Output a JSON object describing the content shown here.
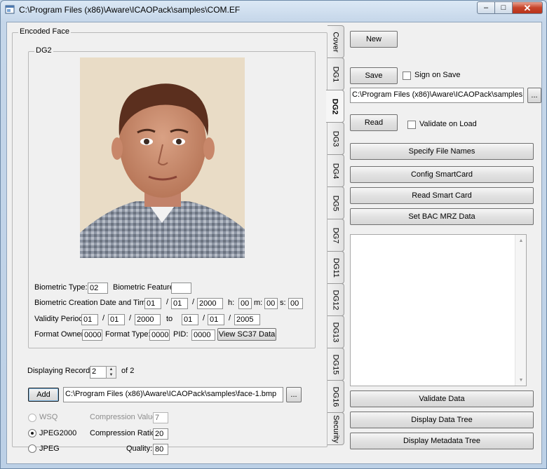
{
  "window": {
    "title": "C:\\Program Files (x86)\\Aware\\ICAOPack\\samples\\COM.EF",
    "minimize_glyph": "–",
    "maximize_glyph": "□",
    "close_glyph": "✕"
  },
  "encoded_face": {
    "legend": "Encoded Face",
    "dg2_legend": "DG2",
    "biometric_type_label": "Biometric Type:",
    "biometric_type": "02",
    "biometric_feature_label": "Biometric Feature:",
    "biometric_feature": "",
    "creation_label": "Biometric Creation Date and Time:",
    "creation_day": "01",
    "creation_month": "01",
    "creation_year": "2000",
    "h_label": "h:",
    "hour": "00",
    "m_label": "m:",
    "minute": "00",
    "s_label": "s:",
    "second": "00",
    "slash": "/",
    "validity_label": "Validity Period:",
    "valid_from_day": "01",
    "valid_from_month": "01",
    "valid_from_year": "2000",
    "to_label": "to",
    "valid_to_day": "01",
    "valid_to_month": "01",
    "valid_to_year": "2005",
    "format_owner_label": "Format Owner:",
    "format_owner": "0000",
    "format_type_label": "Format Type:",
    "format_type": "0000",
    "pid_label": "PID:",
    "pid": "0000",
    "view_sc37_label": "View SC37 Data",
    "displaying_record_label": "Displaying Record:",
    "record": "2",
    "of_label": "of 2",
    "add_label": "Add",
    "image_path": "C:\\Program Files (x86)\\Aware\\ICAOPack\\samples\\face-1.bmp",
    "browse_label": "...",
    "wsq_label": "WSQ",
    "jpeg2000_label": "JPEG2000",
    "jpeg_label": "JPEG",
    "compression_value_label": "Compression Value:",
    "compression_value": "7",
    "compression_ratio_label": "Compression Ratio:",
    "compression_ratio": "20",
    "quality_label": "Quality:",
    "quality": "80",
    "selected_format": "JPEG2000"
  },
  "tabs": [
    {
      "label": "Cover",
      "active": false
    },
    {
      "label": "DG1",
      "active": false
    },
    {
      "label": "DG2",
      "active": true
    },
    {
      "label": "DG3",
      "active": false
    },
    {
      "label": "DG4",
      "active": false
    },
    {
      "label": "DG5",
      "active": false
    },
    {
      "label": "DG7",
      "active": false
    },
    {
      "label": "DG11",
      "active": false
    },
    {
      "label": "DG12",
      "active": false
    },
    {
      "label": "DG13",
      "active": false
    },
    {
      "label": "DG15",
      "active": false
    },
    {
      "label": "DG16",
      "active": false
    },
    {
      "label": "Security",
      "active": false
    }
  ],
  "right_panel": {
    "new_label": "New",
    "save_label": "Save",
    "sign_on_save_label": "Sign on Save",
    "path": "C:\\Program Files (x86)\\Aware\\ICAOPack\\samples",
    "browse_label": "...",
    "read_label": "Read",
    "validate_on_load_label": "Validate on Load",
    "specify_file_names_label": "Specify File Names",
    "config_smartcard_label": "Config SmartCard",
    "read_smart_card_label": "Read Smart Card",
    "set_bac_label": "Set BAC MRZ Data",
    "validate_data_label": "Validate Data",
    "display_data_tree_label": "Display Data Tree",
    "display_metadata_tree_label": "Display Metadata Tree"
  }
}
